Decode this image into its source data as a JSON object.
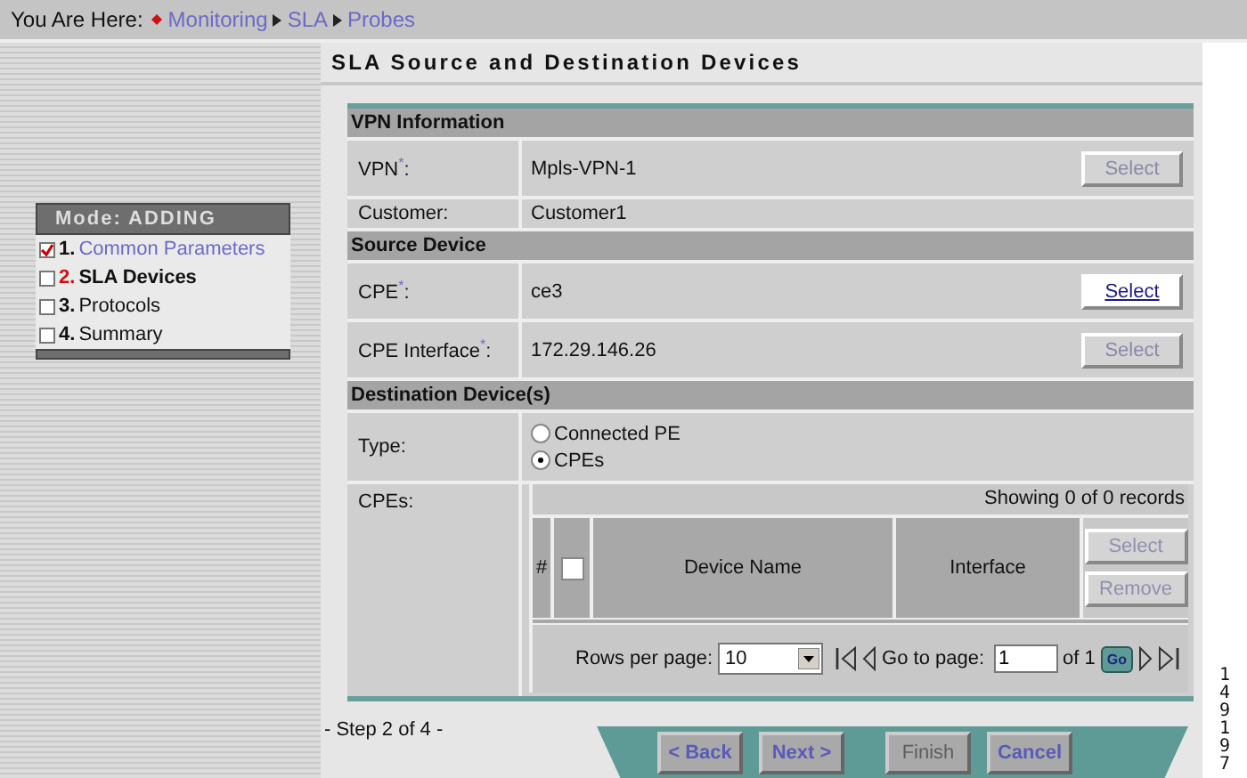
{
  "breadcrumb": {
    "label": "You Are Here:",
    "items": [
      "Monitoring",
      "SLA",
      "Probes"
    ]
  },
  "wizard": {
    "mode": "Mode: ADDING",
    "steps": [
      {
        "number": "1.",
        "label": "Common Parameters",
        "checked": true,
        "current": false
      },
      {
        "number": "2.",
        "label": "SLA Devices",
        "checked": false,
        "current": true
      },
      {
        "number": "3.",
        "label": "Protocols",
        "checked": false,
        "current": false
      },
      {
        "number": "4.",
        "label": "Summary",
        "checked": false,
        "current": false
      }
    ]
  },
  "page_title": "SLA Source and Destination Devices",
  "sections": [
    {
      "title": "VPN Information",
      "rows": [
        {
          "kind": "field",
          "label": "VPN$^{*}$:",
          "value": "Mpls-VPN-1",
          "button": {
            "label": "Select",
            "disabled": true
          }
        },
        {
          "kind": "field",
          "label": "Customer:",
          "value": "Customer1"
        }
      ]
    },
    {
      "title": "Source Device",
      "rows": [
        {
          "kind": "field",
          "label": "CPE$^{*}$:",
          "value": "ce3",
          "button": {
            "label": "Select",
            "disabled": false
          }
        },
        {
          "kind": "field",
          "label": "CPE Interface$^{*}$:",
          "value": "172.29.146.26",
          "button": {
            "label": "Select",
            "disabled": true
          }
        }
      ]
    },
    {
      "title": "Destination Device(s)",
      "rows": [
        {
          "kind": "radio",
          "label": "Type:",
          "options": [
            {
              "label": "Connected PE",
              "selected": false
            },
            {
              "label": "CPEs",
              "selected": true
            }
          ]
        },
        {
          "kind": "table",
          "label": "CPEs:",
          "records": "Showing 0 of 0 records",
          "select_all_checked": false,
          "columns": [
            "#",
            "Device Name",
            "Interface"
          ],
          "buttons": [
            {
              "label": "Select",
              "disabled": true
            },
            {
              "label": "Remove",
              "disabled": true
            }
          ],
          "rows_per_page_label": "Rows per page:",
          "rows_per_page": "10",
          "go_to_label": "Go to page:",
          "page": "1",
          "of_pages": "of 1",
          "go": "Go"
        }
      ]
    }
  ],
  "step": "- Step 2 of 4 -",
  "footer_buttons": [
    {
      "label": "< Back",
      "disabled": false
    },
    {
      "label": "Next >",
      "disabled": false
    },
    {
      "label": "Finish",
      "disabled": true
    },
    {
      "label": "Cancel",
      "disabled": false
    }
  ],
  "figure_number": "149197"
}
